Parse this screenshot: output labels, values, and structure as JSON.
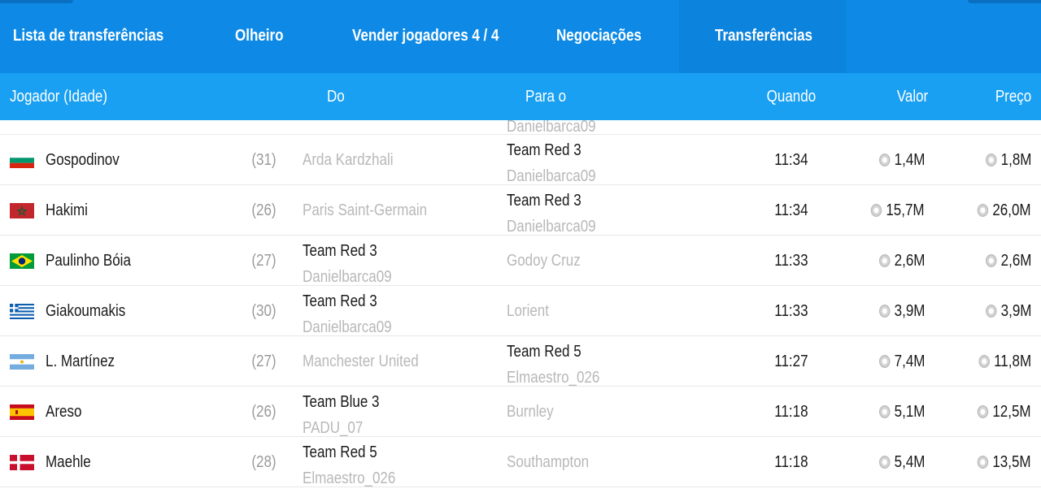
{
  "tabs": [
    {
      "label": "Lista de transferências"
    },
    {
      "label": "Olheiro"
    },
    {
      "label": "Vender jogadores 4 / 4"
    },
    {
      "label": "Negociações"
    },
    {
      "label": "Transferências"
    }
  ],
  "columns": {
    "player": "Jogador (Idade)",
    "from": "Do",
    "to": "Para o",
    "when": "Quando",
    "value": "Valor",
    "price": "Preço"
  },
  "partial_row": {
    "to_manager": "Danielbarca09"
  },
  "rows": [
    {
      "flag": "bulgaria",
      "name": "Gospodinov",
      "age": "(31)",
      "from_club": "Arda Kardzhali",
      "from_manager": "",
      "to_club": "Team Red 3",
      "to_manager": "Danielbarca09",
      "when": "11:34",
      "value": "1,4M",
      "price": "1,8M"
    },
    {
      "flag": "morocco",
      "name": "Hakimi",
      "age": "(26)",
      "from_club": "Paris Saint-Germain",
      "from_manager": "",
      "to_club": "Team Red 3",
      "to_manager": "Danielbarca09",
      "when": "11:34",
      "value": "15,7M",
      "price": "26,0M"
    },
    {
      "flag": "brazil",
      "name": "Paulinho Bóia",
      "age": "(27)",
      "from_club": "Team Red 3",
      "from_manager": "Danielbarca09",
      "to_club": "Godoy Cruz",
      "to_manager": "",
      "when": "11:33",
      "value": "2,6M",
      "price": "2,6M"
    },
    {
      "flag": "greece",
      "name": "Giakoumakis",
      "age": "(30)",
      "from_club": "Team Red 3",
      "from_manager": "Danielbarca09",
      "to_club": "Lorient",
      "to_manager": "",
      "when": "11:33",
      "value": "3,9M",
      "price": "3,9M"
    },
    {
      "flag": "argentina",
      "name": "L. Martínez",
      "age": "(27)",
      "from_club": "Manchester United",
      "from_manager": "",
      "to_club": "Team Red 5",
      "to_manager": "Elmaestro_026",
      "when": "11:27",
      "value": "7,4M",
      "price": "11,8M"
    },
    {
      "flag": "spain",
      "name": "Areso",
      "age": "(26)",
      "from_club": "Team Blue 3",
      "from_manager": "PADU_07",
      "to_club": "Burnley",
      "to_manager": "",
      "when": "11:18",
      "value": "5,1M",
      "price": "12,5M"
    },
    {
      "flag": "denmark",
      "name": "Maehle",
      "age": "(28)",
      "from_club": "Team Red 5",
      "from_manager": "Elmaestro_026",
      "to_club": "Southampton",
      "to_manager": "",
      "when": "11:18",
      "value": "5,4M",
      "price": "13,5M"
    }
  ],
  "icons": {
    "coin": "coin-icon"
  },
  "colors": {
    "tab_bar": "#0e8ae6",
    "header_row": "#19a0f2",
    "muted_text": "#b8b8b8"
  }
}
